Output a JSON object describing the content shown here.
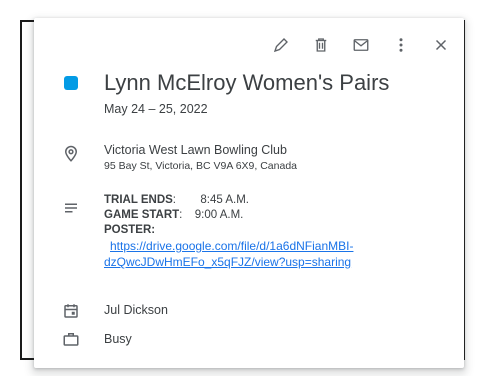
{
  "toolbar": {
    "icons": [
      "pencil-icon",
      "trash-icon",
      "envelope-icon",
      "more-vert-icon",
      "close-icon"
    ]
  },
  "event": {
    "title": "Lynn McElroy Women's Pairs",
    "date": "May 24 – 25, 2022",
    "color": "#039be5"
  },
  "location": {
    "name": "Victoria West Lawn Bowling Club",
    "address": "95 Bay St, Victoria, BC V9A 6X9, Canada"
  },
  "description": {
    "trial_label": "TRIAL ENDS",
    "trial_colon": ":",
    "trial_time": "8:45 A.M.",
    "game_label": "GAME START",
    "game_colon": ":",
    "game_time": "9:00 A.M.",
    "poster_label": "POSTER:",
    "poster_link_line1": "https://drive.google.com/file/d/1a6dNFianMBI-",
    "poster_link_line2": "dzQwcJDwHmEFo_x5qFJZ/view?usp=sharing"
  },
  "calendar": {
    "owner": "Jul Dickson"
  },
  "availability": {
    "status": "Busy"
  }
}
